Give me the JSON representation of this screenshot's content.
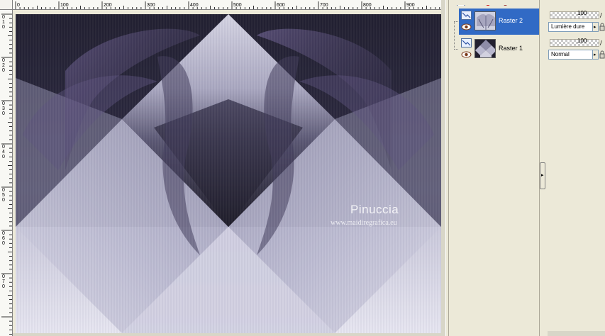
{
  "ruler": {
    "top_labels": [
      "0",
      "100",
      "200",
      "300",
      "400",
      "500",
      "600",
      "700",
      "800",
      "900"
    ],
    "left_labels": [
      "0",
      "1",
      "0",
      "0",
      "2",
      "0",
      "0",
      "3",
      "0",
      "0",
      "4",
      "0",
      "0",
      "5",
      "0",
      "0",
      "6",
      "0",
      "0",
      "7",
      "0"
    ]
  },
  "watermark": {
    "name": "Pinuccia",
    "url": "www.maidiregrafica.eu"
  },
  "layers": [
    {
      "name": "Raster 2",
      "selected": true,
      "blend_mode": "Lumière dure",
      "opacity": "100"
    },
    {
      "name": "Raster 1",
      "selected": false,
      "blend_mode": "Normal",
      "opacity": "100"
    }
  ],
  "icons": {
    "layer_type": "raster-layer-icon",
    "visibility": "eye-icon",
    "toolbar": [
      "new-layer-icon",
      "delete-icon",
      "edit-icon"
    ],
    "collapse": "expand-arrow-icon",
    "link": "link-icon"
  },
  "colors": {
    "panel_bg": "#ece9d8",
    "selection": "#316ac5"
  }
}
